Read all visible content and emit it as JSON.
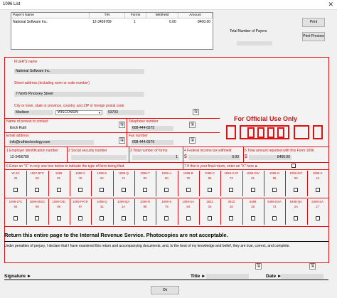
{
  "window": {
    "title": "1096 List",
    "close": "✕"
  },
  "payer_list": {
    "columns": [
      "Payer's Name",
      "TIN",
      "Forms",
      "Withheld",
      "Amount"
    ],
    "rows": [
      {
        "name": "National Software Inc.",
        "tin": "12-3456789",
        "forms": "1",
        "withheld": "0.00",
        "amount": "8400.00"
      }
    ]
  },
  "buttons": {
    "print": "Print",
    "preview": "Print Preview",
    "ok": "Ok"
  },
  "total_payers_label": "Total Number of Payers",
  "filer": {
    "label": "FILER'S name",
    "name": "National Software Inc.",
    "street_label": "Street address (including room or suite number)",
    "street": "7 North Pinckney Street",
    "city_label": "City or town, state or province, country, and ZIP or foreign postal code",
    "city": "Madison",
    "state": "WISCONSIN",
    "zip": "53703"
  },
  "contact": {
    "label": "Name of person to contact",
    "value": "Erich Ruth"
  },
  "telephone": {
    "label": "Telephone number",
    "value": "608-444-6575"
  },
  "email": {
    "label": "Email address",
    "value": "info@ruthtechnology.com"
  },
  "fax": {
    "label": "Fax number",
    "value": "608-444-6576"
  },
  "official_use": "For Official Use Only",
  "boxes": {
    "b1_num": "1",
    "b1": "Employer identification number",
    "b1_val": "12-3456789",
    "b2_num": "2",
    "b2": "Social security number",
    "b3_num": "3",
    "b3": "Total number of forms",
    "b3_val": "1",
    "b4_num": "4",
    "b4": "Federal income tax withheld",
    "b4_cur": "$",
    "b4_val": "0.00",
    "b5_num": "5",
    "b5": "Total amount reported with this Form 1096",
    "b5_cur": "$",
    "b5_val": "8400.00"
  },
  "box6_num": "6",
  "box6": "Enter an \"X\" in only one box below to indicate the type of form being filed.",
  "box7_num": "7",
  "box7": "If this is your final return, enter an \"X\" here",
  "row1": [
    {
      "name": "W-2G",
      "code": "32"
    },
    {
      "name": "1097-BTC",
      "code": "50"
    },
    {
      "name": "1098",
      "code": "81"
    },
    {
      "name": "1098-C",
      "code": "78"
    },
    {
      "name": "1098-E",
      "code": "84"
    },
    {
      "name": "1098-Q",
      "code": "74"
    },
    {
      "name": "1098-T",
      "code": "83"
    },
    {
      "name": "1099-A",
      "code": "80"
    },
    {
      "name": "1099-B",
      "code": "79"
    },
    {
      "name": "1099-C",
      "code": "85"
    },
    {
      "name": "1099-CAP",
      "code": "73"
    },
    {
      "name": "1099-DIV",
      "code": "91"
    },
    {
      "name": "1099-G",
      "code": "86"
    },
    {
      "name": "1099-INT",
      "code": "92"
    },
    {
      "name": "1099-K",
      "code": "10"
    }
  ],
  "row2": [
    {
      "name": "1099-LTC",
      "code": "93"
    },
    {
      "name": "1099-MISC",
      "code": "95"
    },
    {
      "name": "1099-OID",
      "code": "96"
    },
    {
      "name": "1099-PATR",
      "code": "97"
    },
    {
      "name": "1099-Q",
      "code": "31"
    },
    {
      "name": "1099-QA",
      "code": "1A"
    },
    {
      "name": "1099-R",
      "code": "98"
    },
    {
      "name": "1099-S",
      "code": "75"
    },
    {
      "name": "1099-SA",
      "code": "94"
    },
    {
      "name": "3921",
      "code": "25"
    },
    {
      "name": "3922",
      "code": "26"
    },
    {
      "name": "5498",
      "code": "28"
    },
    {
      "name": "5498-ESA",
      "code": "72"
    },
    {
      "name": "5498-QA",
      "code": "2A"
    },
    {
      "name": "5498-SA",
      "code": "27"
    }
  ],
  "return_notice": "Return this entire page to the Internal Revenue Service. Photocopies are not acceptable.",
  "perjury": "Under penalties of perjury, I declare that I have examined this return and accompanying documents, and, to the best of my knowledge and belief, they are true, correct, and complete.",
  "signature_label": "Signature ►",
  "title_label": "Title ►",
  "date_label": "Date ►"
}
